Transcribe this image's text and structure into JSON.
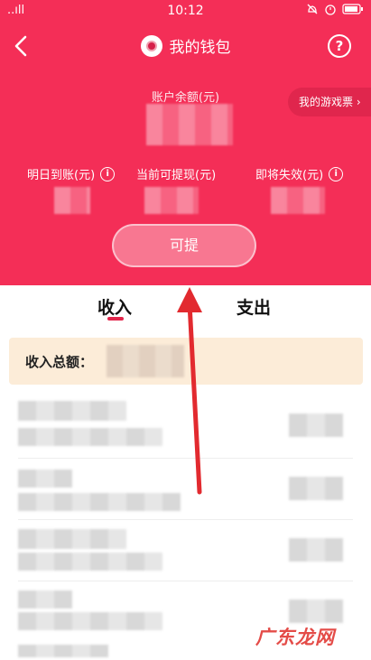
{
  "status_bar": {
    "signal": "..ıll",
    "time": "10:12"
  },
  "header": {
    "title": "我的钱包",
    "help_glyph": "?"
  },
  "balance": {
    "label": "账户余额(元)",
    "ticket_button": "我的游戏票 ›"
  },
  "stats": [
    {
      "label": "明日到账(元)"
    },
    {
      "label": "当前可提现(元)"
    },
    {
      "label": "即将失效(元)"
    }
  ],
  "withdraw_button": "可提",
  "tabs": {
    "income": "收入",
    "expense": "支出"
  },
  "summary": {
    "label": "收入总额："
  },
  "watermark": "广东龙网",
  "colors": {
    "brand_red": "#f42e57",
    "summary_bg": "#fcecd8",
    "tab_underline": "#e2254b"
  }
}
